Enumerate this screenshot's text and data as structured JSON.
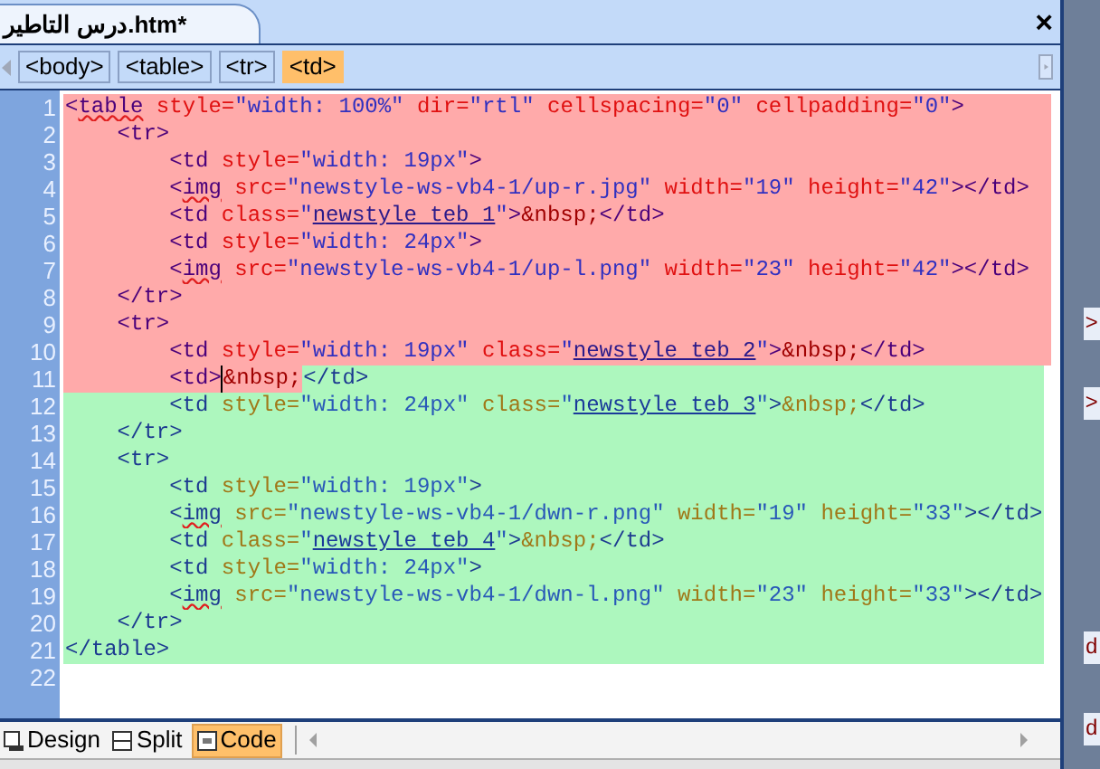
{
  "document_tab": {
    "title": "درس التاطير.htm*",
    "close": "×"
  },
  "tag_path": [
    {
      "label": "<body>",
      "selected": false
    },
    {
      "label": "<table>",
      "selected": false
    },
    {
      "label": "<tr>",
      "selected": false
    },
    {
      "label": "<td>",
      "selected": true
    }
  ],
  "code_lines": [
    {
      "num": "1",
      "segments": [
        {
          "kind": "pink",
          "tokens": [
            {
              "kind": "tag",
              "t": "<"
            },
            {
              "kind": "tag",
              "t": "table",
              "misspelled": true
            },
            {
              "kind": "attr",
              "t": " style="
            },
            {
              "kind": "value",
              "t": "\"width: 100%\""
            },
            {
              "kind": "attr",
              "t": " dir="
            },
            {
              "kind": "value",
              "t": "\"rtl\""
            },
            {
              "kind": "attr",
              "t": " cellspacing="
            },
            {
              "kind": "value",
              "t": "\"0\""
            },
            {
              "kind": "attr",
              "t": " cellpadding="
            },
            {
              "kind": "value",
              "t": "\"0\""
            },
            {
              "kind": "tag",
              "t": ">"
            }
          ]
        }
      ]
    },
    {
      "num": "2",
      "segments": [
        {
          "kind": "pink",
          "tokens": [
            {
              "kind": "tag",
              "t": "    <tr>"
            }
          ]
        }
      ]
    },
    {
      "num": "3",
      "segments": [
        {
          "kind": "pink",
          "tokens": [
            {
              "kind": "tag",
              "t": "        <td"
            },
            {
              "kind": "attr",
              "t": " style="
            },
            {
              "kind": "value",
              "t": "\"width: 19px\""
            },
            {
              "kind": "tag",
              "t": ">"
            }
          ]
        }
      ]
    },
    {
      "num": "4",
      "segments": [
        {
          "kind": "pink",
          "tokens": [
            {
              "kind": "tag",
              "t": "        <"
            },
            {
              "kind": "tag",
              "t": "img",
              "misspelled": true
            },
            {
              "kind": "attr",
              "t": " src="
            },
            {
              "kind": "value",
              "t": "\"newstyle-ws-vb4-1/up-r.jpg\""
            },
            {
              "kind": "attr",
              "t": " width="
            },
            {
              "kind": "value",
              "t": "\"19\""
            },
            {
              "kind": "attr",
              "t": " height="
            },
            {
              "kind": "value",
              "t": "\"42\""
            },
            {
              "kind": "tag",
              "t": "></td>"
            }
          ]
        }
      ]
    },
    {
      "num": "5",
      "segments": [
        {
          "kind": "pink",
          "tokens": [
            {
              "kind": "tag",
              "t": "        <td"
            },
            {
              "kind": "attr",
              "t": " class="
            },
            {
              "kind": "value",
              "t": "\""
            },
            {
              "kind": "link",
              "t": "newstyle teb 1"
            },
            {
              "kind": "value",
              "t": "\""
            },
            {
              "kind": "tag",
              "t": ">"
            },
            {
              "kind": "entity",
              "t": "&nbsp;"
            },
            {
              "kind": "tag",
              "t": "</td>"
            }
          ]
        }
      ]
    },
    {
      "num": "6",
      "segments": [
        {
          "kind": "pink",
          "tokens": [
            {
              "kind": "tag",
              "t": "        <td"
            },
            {
              "kind": "attr",
              "t": " style="
            },
            {
              "kind": "value",
              "t": "\"width: 24px\""
            },
            {
              "kind": "tag",
              "t": ">"
            }
          ]
        }
      ]
    },
    {
      "num": "7",
      "segments": [
        {
          "kind": "pink",
          "tokens": [
            {
              "kind": "tag",
              "t": "        <"
            },
            {
              "kind": "tag",
              "t": "img",
              "misspelled": true
            },
            {
              "kind": "attr",
              "t": " src="
            },
            {
              "kind": "value",
              "t": "\"newstyle-ws-vb4-1/up-l.png\""
            },
            {
              "kind": "attr",
              "t": " width="
            },
            {
              "kind": "value",
              "t": "\"23\""
            },
            {
              "kind": "attr",
              "t": " height="
            },
            {
              "kind": "value",
              "t": "\"42\""
            },
            {
              "kind": "tag",
              "t": "></td>"
            }
          ]
        }
      ]
    },
    {
      "num": "8",
      "segments": [
        {
          "kind": "pink",
          "tokens": [
            {
              "kind": "tag",
              "t": "    </tr>"
            }
          ]
        }
      ]
    },
    {
      "num": "9",
      "segments": [
        {
          "kind": "pink",
          "tokens": [
            {
              "kind": "tag",
              "t": "    <tr>"
            }
          ]
        }
      ]
    },
    {
      "num": "10",
      "segments": [
        {
          "kind": "pink",
          "tokens": [
            {
              "kind": "tag",
              "t": "        <td"
            },
            {
              "kind": "attr",
              "t": " style="
            },
            {
              "kind": "value",
              "t": "\"width: 19px\""
            },
            {
              "kind": "attr",
              "t": " class="
            },
            {
              "kind": "value",
              "t": "\""
            },
            {
              "kind": "link",
              "t": "newstyle teb 2"
            },
            {
              "kind": "value",
              "t": "\""
            },
            {
              "kind": "tag",
              "t": ">"
            },
            {
              "kind": "entity",
              "t": "&nbsp;"
            },
            {
              "kind": "tag",
              "t": "</td>"
            }
          ]
        }
      ]
    },
    {
      "num": "11",
      "segments": [
        {
          "kind": "pink",
          "tokens": [
            {
              "kind": "tag",
              "t": "        <td>"
            },
            {
              "kind": "caret"
            },
            {
              "kind": "entity",
              "t": "&nbsp;"
            }
          ]
        },
        {
          "kind": "green",
          "tokens": [
            {
              "kind": "tag",
              "t": "</td>"
            }
          ]
        }
      ]
    },
    {
      "num": "12",
      "segments": [
        {
          "kind": "green",
          "tokens": [
            {
              "kind": "tag",
              "t": "        <td"
            },
            {
              "kind": "attr",
              "t": " style="
            },
            {
              "kind": "value",
              "t": "\"width: 24px\""
            },
            {
              "kind": "attr",
              "t": " class="
            },
            {
              "kind": "value",
              "t": "\""
            },
            {
              "kind": "link",
              "t": "newstyle teb 3"
            },
            {
              "kind": "value",
              "t": "\""
            },
            {
              "kind": "tag",
              "t": ">"
            },
            {
              "kind": "entity",
              "t": "&nbsp;"
            },
            {
              "kind": "tag",
              "t": "</td>"
            }
          ]
        }
      ]
    },
    {
      "num": "13",
      "segments": [
        {
          "kind": "green",
          "tokens": [
            {
              "kind": "tag",
              "t": "    </tr>"
            }
          ]
        }
      ]
    },
    {
      "num": "14",
      "segments": [
        {
          "kind": "green",
          "tokens": [
            {
              "kind": "tag",
              "t": "    <tr>"
            }
          ]
        }
      ]
    },
    {
      "num": "15",
      "segments": [
        {
          "kind": "green",
          "tokens": [
            {
              "kind": "tag",
              "t": "        <td"
            },
            {
              "kind": "attr",
              "t": " style="
            },
            {
              "kind": "value",
              "t": "\"width: 19px\""
            },
            {
              "kind": "tag",
              "t": ">"
            }
          ]
        }
      ]
    },
    {
      "num": "16",
      "segments": [
        {
          "kind": "green",
          "tokens": [
            {
              "kind": "tag",
              "t": "        <"
            },
            {
              "kind": "tag",
              "t": "img",
              "misspelled": true
            },
            {
              "kind": "attr",
              "t": " src="
            },
            {
              "kind": "value",
              "t": "\"newstyle-ws-vb4-1/dwn-r.png\""
            },
            {
              "kind": "attr",
              "t": " width="
            },
            {
              "kind": "value",
              "t": "\"19\""
            },
            {
              "kind": "attr",
              "t": " height="
            },
            {
              "kind": "value",
              "t": "\"33\""
            },
            {
              "kind": "tag",
              "t": "></td>"
            }
          ]
        }
      ]
    },
    {
      "num": "17",
      "segments": [
        {
          "kind": "green",
          "tokens": [
            {
              "kind": "tag",
              "t": "        <td"
            },
            {
              "kind": "attr",
              "t": " class="
            },
            {
              "kind": "value",
              "t": "\""
            },
            {
              "kind": "link",
              "t": "newstyle teb 4"
            },
            {
              "kind": "value",
              "t": "\""
            },
            {
              "kind": "tag",
              "t": ">"
            },
            {
              "kind": "entity",
              "t": "&nbsp;"
            },
            {
              "kind": "tag",
              "t": "</td>"
            }
          ]
        }
      ]
    },
    {
      "num": "18",
      "segments": [
        {
          "kind": "green",
          "tokens": [
            {
              "kind": "tag",
              "t": "        <td"
            },
            {
              "kind": "attr",
              "t": " style="
            },
            {
              "kind": "value",
              "t": "\"width: 24px\""
            },
            {
              "kind": "tag",
              "t": ">"
            }
          ]
        }
      ]
    },
    {
      "num": "19",
      "segments": [
        {
          "kind": "green",
          "tokens": [
            {
              "kind": "tag",
              "t": "        <"
            },
            {
              "kind": "tag",
              "t": "img",
              "misspelled": true
            },
            {
              "kind": "attr",
              "t": " src="
            },
            {
              "kind": "value",
              "t": "\"newstyle-ws-vb4-1/dwn-l.png\""
            },
            {
              "kind": "attr",
              "t": " width="
            },
            {
              "kind": "value",
              "t": "\"23\""
            },
            {
              "kind": "attr",
              "t": " height="
            },
            {
              "kind": "value",
              "t": "\"33\""
            },
            {
              "kind": "tag",
              "t": "></td>"
            }
          ]
        }
      ]
    },
    {
      "num": "20",
      "segments": [
        {
          "kind": "green",
          "tokens": [
            {
              "kind": "tag",
              "t": "    </tr>"
            }
          ]
        }
      ]
    },
    {
      "num": "21",
      "segments": [
        {
          "kind": "green",
          "tokens": [
            {
              "kind": "tag",
              "t": "</table>"
            }
          ]
        }
      ]
    },
    {
      "num": "22"
    }
  ],
  "view_tabs": [
    {
      "label": "Design",
      "selected": false,
      "kind": "design"
    },
    {
      "label": "Split",
      "selected": false,
      "kind": "split"
    },
    {
      "label": "Code",
      "selected": true,
      "kind": "code"
    }
  ],
  "side_panel_fragments": [
    ">",
    ">",
    "d",
    "d"
  ]
}
